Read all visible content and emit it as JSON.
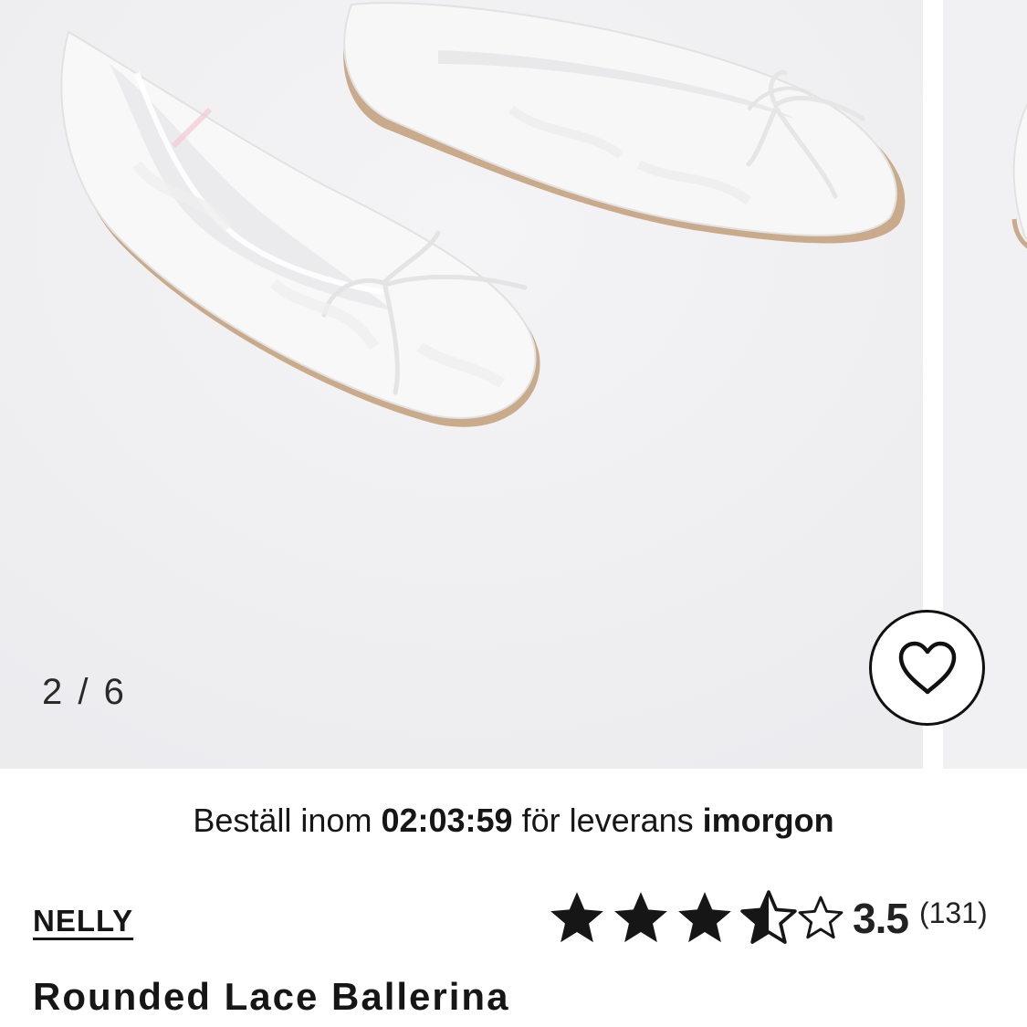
{
  "gallery": {
    "current_image": 2,
    "total_images": 6,
    "counter_text": "2 / 6"
  },
  "favorite": {
    "icon": "heart-icon"
  },
  "delivery": {
    "prefix": "Beställ inom ",
    "countdown": "02:03:59",
    "middle": " för leverans ",
    "day": "imorgon"
  },
  "product": {
    "brand": "NELLY",
    "name": "Rounded Lace Ballerina",
    "rating": {
      "value": 3.5,
      "value_text": "3.5",
      "count_text": "(131)",
      "max": 5
    }
  },
  "colors": {
    "image_bg": "#f1f1f3",
    "text": "#161616",
    "star": "#161616"
  }
}
